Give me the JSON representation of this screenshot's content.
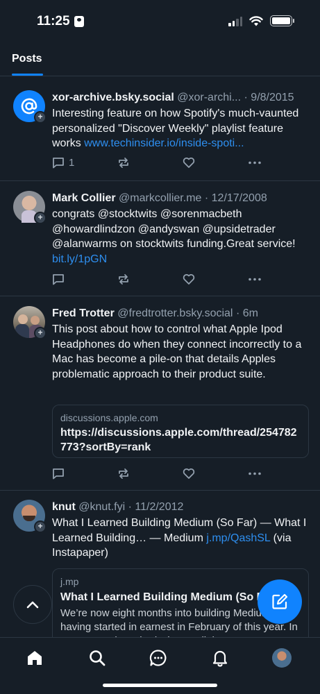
{
  "status_bar": {
    "time": "11:25"
  },
  "tabs": {
    "active_label": "Posts"
  },
  "posts": [
    {
      "name": "xor-archive.bsky.social",
      "handle": "@xor-archi...",
      "separator": "·",
      "time": "9/8/2015",
      "text": "Interesting feature on how Spotify's much-vaunted personalized \"Discover Weekly\" playlist feature works ",
      "link": "www.techinsider.io/inside-spoti...",
      "reply_count": "1"
    },
    {
      "name": "Mark Collier",
      "handle": "@markcollier.me",
      "separator": "·",
      "time": "12/17/2008",
      "text": "congrats @stocktwits @sorenmacbeth @howardlindzon @andyswan @upsidetrader @alanwarms on stocktwits funding.Great service! ",
      "link": "bit.ly/1pGN",
      "reply_count": ""
    },
    {
      "name": "Fred Trotter",
      "handle": "@fredtrotter.bsky.social",
      "separator": "·",
      "time": "6m",
      "text": "This post about how to control what Apple Ipod Headphones do when they connect incorrectly to a Mac has become a pile-on that details Apples problematic approach to their product suite.",
      "link": "",
      "reply_count": "",
      "embed": {
        "domain": "discussions.apple.com",
        "title": "https://discussions.apple.com/thread/254782773?sortBy=rank"
      }
    },
    {
      "name": "knut",
      "handle": "@knut.fyi",
      "separator": "·",
      "time": "11/2/2012",
      "text": "What I Learned Building Medium (So Far) — What I Learned Building… — Medium ",
      "link": "j.mp/QashSL",
      "text_after": " (via Instapaper)",
      "reply_count": "",
      "embed": {
        "domain": "j.mp",
        "title": "What I Learned Building Medium (So Far)",
        "description": "We’re now eight months into building Medium, having started in earnest in February of this year. In August, we launched what I call the"
      }
    }
  ],
  "colors": {
    "background": "#161e27",
    "accent": "#1083fe",
    "link": "#2e8ff0",
    "muted": "#93a0ae",
    "divider": "#2c3743"
  },
  "icons": {
    "reply": "speech-bubble-icon",
    "repost": "repost-arrows-icon",
    "like": "heart-icon",
    "more": "ellipsis-icon",
    "home": "home-icon",
    "search": "search-icon",
    "chat": "chat-bubble-icon",
    "notifications": "bell-icon",
    "compose": "pencil-square-icon",
    "scroll_top": "chevron-up-icon"
  }
}
